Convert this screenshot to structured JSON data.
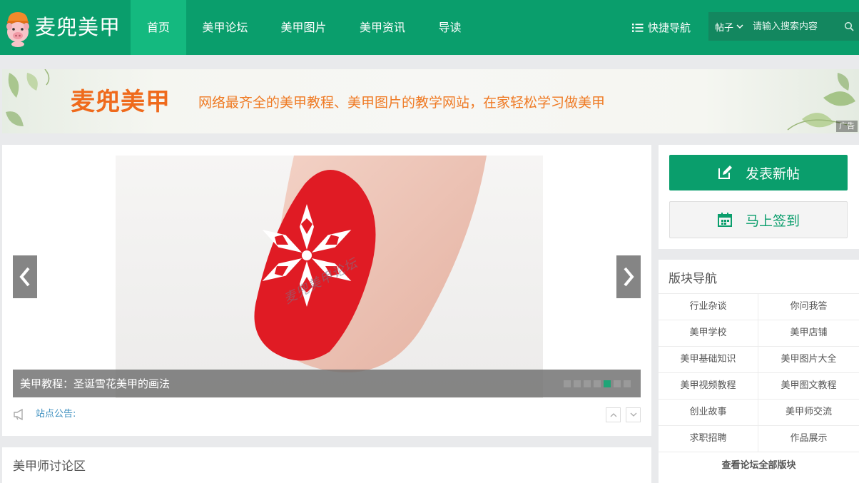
{
  "header": {
    "logo_text": "麦兜美甲",
    "nav": [
      {
        "label": "首页",
        "active": true
      },
      {
        "label": "美甲论坛",
        "active": false
      },
      {
        "label": "美甲图片",
        "active": false
      },
      {
        "label": "美甲资讯",
        "active": false
      },
      {
        "label": "导读",
        "active": false
      }
    ],
    "quick_nav_label": "快捷导航",
    "search": {
      "type_label": "帖子",
      "placeholder": "请输入搜索内容"
    }
  },
  "banner": {
    "brand": "麦兜美甲",
    "slogan": "网络最齐全的美甲教程、美甲图片的教学网站，在家轻松学习做美甲",
    "ad_label": "广告"
  },
  "slider": {
    "caption": "美甲教程：圣诞雪花美甲的画法",
    "watermark": "麦兜美甲论坛",
    "dot_count": 7,
    "active_dot": 5
  },
  "notice": {
    "label": "站点公告:"
  },
  "section": {
    "title": "美甲师讨论区"
  },
  "sidebar": {
    "post_button": "发表新帖",
    "sign_button": "马上签到",
    "board_nav_title": "版块导航",
    "boards": [
      "行业杂谈",
      "你问我答",
      "美甲学校",
      "美甲店铺",
      "美甲基础知识",
      "美甲图片大全",
      "美甲视频教程",
      "美甲图文教程",
      "创业故事",
      "美甲师交流",
      "求职招聘",
      "作品展示"
    ],
    "view_all": "查看论坛全部版块"
  },
  "colors": {
    "brand_green": "#0a9e6c",
    "nav_active": "#14b97f",
    "banner_orange": "#ef6a1c",
    "nail_red": "#e01b24"
  }
}
